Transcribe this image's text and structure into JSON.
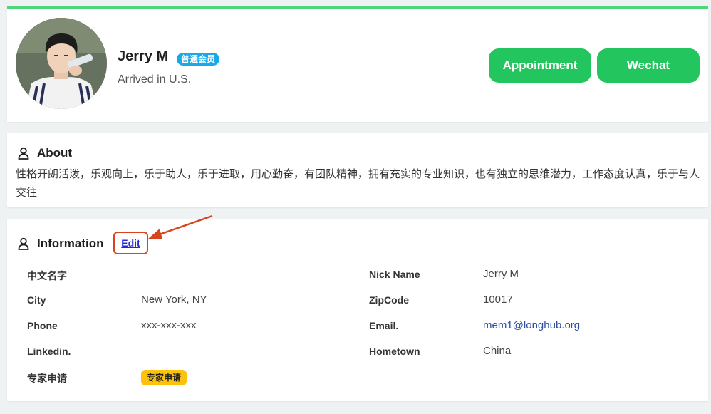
{
  "profile": {
    "name": "Jerry M",
    "member_badge": "普通会员",
    "status": "Arrived in U.S.",
    "appointment_label": "Appointment",
    "wechat_label": "Wechat",
    "accent_color": "#22c55e",
    "top_bar_color": "#4ed67a"
  },
  "about": {
    "title": "About",
    "text": "性格开朗活泼，乐观向上，乐于助人，乐于进取，用心勤奋，有团队精神，拥有充实的专业知识，也有独立的思维潜力，工作态度认真，乐于与人交往"
  },
  "information": {
    "title": "Information",
    "edit_label": "Edit",
    "fields": {
      "chinese_name_label": "中文名字",
      "chinese_name_value": "",
      "nick_name_label": "Nick Name",
      "nick_name_value": "Jerry M",
      "city_label": "City",
      "city_value": "New York, NY",
      "zipcode_label": "ZipCode",
      "zipcode_value": "10017",
      "phone_label": "Phone",
      "phone_value": "xxx-xxx-xxx",
      "email_label": "Email.",
      "email_value": "mem1@longhub.org",
      "linkedin_label": "Linkedin.",
      "linkedin_value": "",
      "hometown_label": "Hometown",
      "hometown_value": "China",
      "expert_label": "专家申请",
      "expert_badge": "专家申请"
    }
  }
}
